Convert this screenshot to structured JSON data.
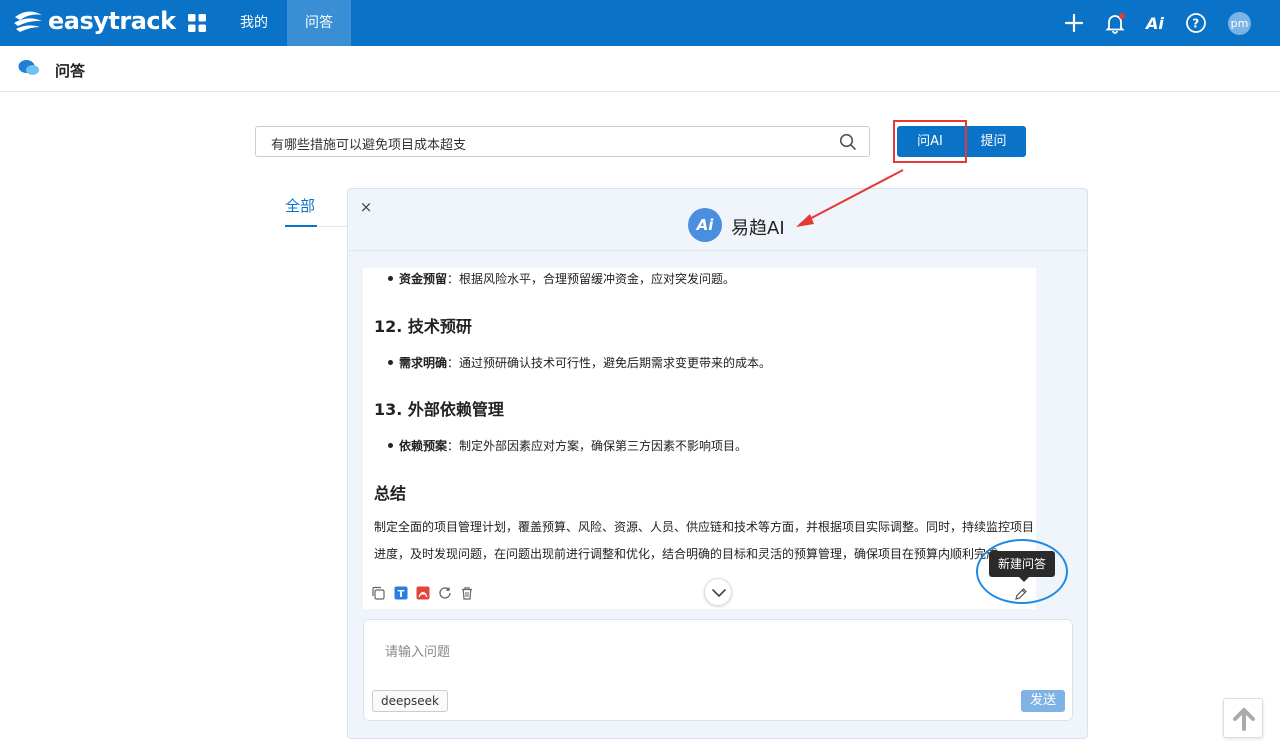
{
  "app": {
    "logo_text": "easytrack",
    "brand_color": "#0a72c7"
  },
  "nav": {
    "mine": "我的",
    "qa": "问答"
  },
  "header_icons": [
    "plus-icon",
    "bell-icon",
    "ai-icon",
    "help-icon"
  ],
  "user": {
    "avatar_initials": "pm"
  },
  "page": {
    "title": "问答"
  },
  "search": {
    "value": "有哪些措施可以避免项目成本超支"
  },
  "buttons": {
    "ask_ai": "问AI",
    "ask_question": "提问"
  },
  "tabs": {
    "all": "全部"
  },
  "ai_panel": {
    "badge": "Ai",
    "title": "易趋AI",
    "close": "×",
    "content": {
      "b1_label": "资金预留",
      "b1_text": "：根据风险水平，合理预留缓冲资金，应对突发问题。",
      "h12": "12. 技术预研",
      "b2_label": "需求明确",
      "b2_text": "：通过预研确认技术可行性，避免后期需求变更带来的成本。",
      "h13": "13. 外部依赖管理",
      "b3_label": "依赖预案",
      "b3_text": "：制定外部因素应对方案，确保第三方因素不影响项目。",
      "summary_title": "总结",
      "summary_text": "制定全面的项目管理计划，覆盖预算、风险、资源、人员、供应链和技术等方面，并根据项目实际调整。同时，持续监控项目进度，及时发现问题，在问题出现前进行调整和优化，结合明确的目标和灵活的预算管理，确保项目在预算内顺利完成。"
    },
    "tooltip": "新建问答",
    "input_placeholder": "请输入问题",
    "model": "deepseek",
    "send": "发送"
  }
}
